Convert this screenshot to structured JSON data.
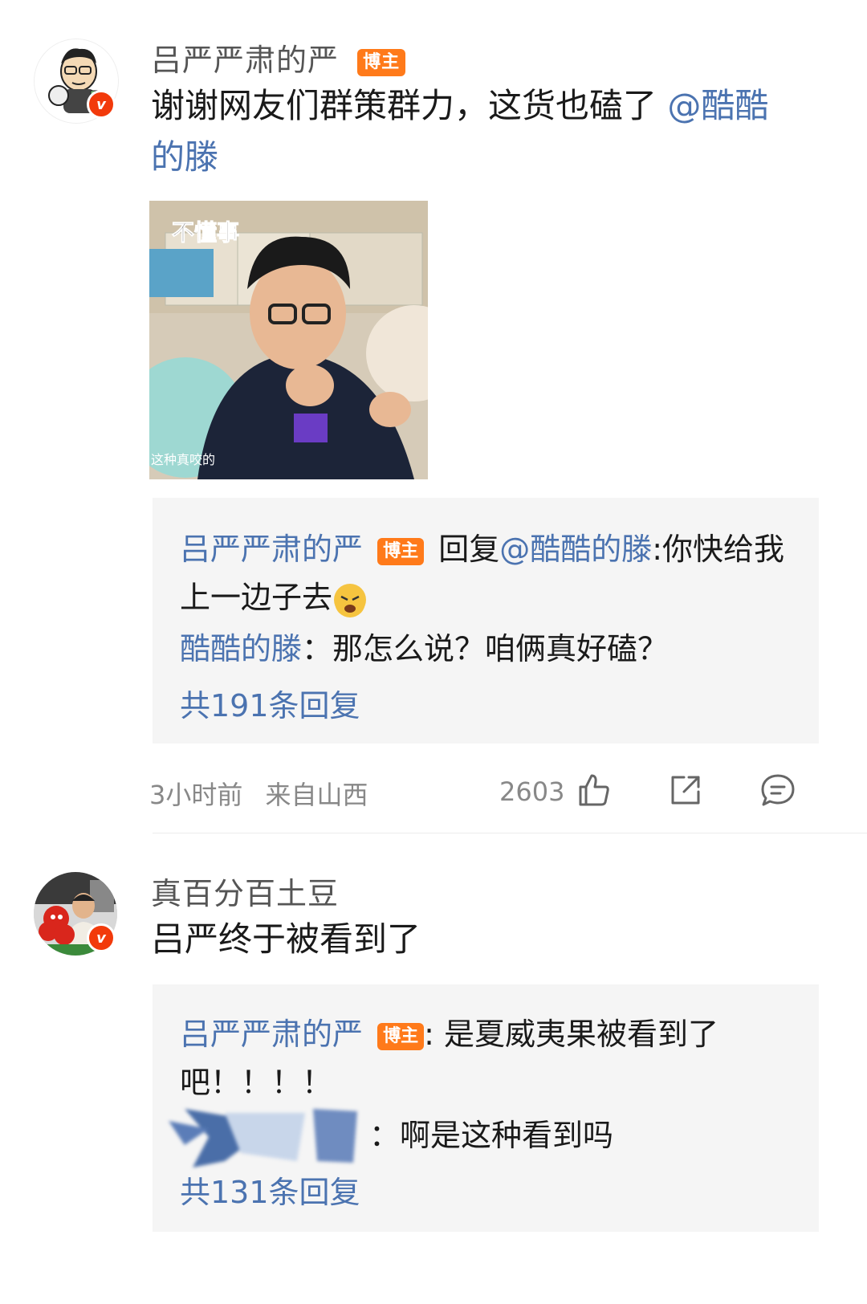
{
  "post1": {
    "username": "吕严严肃的严",
    "tag": "博主",
    "text": "谢谢网友们群策群力，这货也磕了 ",
    "mention": "@酷酷的滕",
    "image_caption_top": "不懂事",
    "image_caption_bottom": "这种真咬的",
    "replies": {
      "line1_user": "吕严严肃的严",
      "line1_tag": "博主",
      "line1_prefix": " 回复",
      "line1_mention": "@酷酷的滕",
      "line1_text": ":你快给我上一边子去",
      "line2_user": "酷酷的滕",
      "line2_text": "：那怎么说？咱俩真好磕？",
      "more": "共191条回复"
    },
    "time": "3小时前",
    "location": "来自山西",
    "likes": "2603"
  },
  "post2": {
    "username": "真百分百土豆",
    "text": "吕严终于被看到了",
    "replies": {
      "line1_user": "吕严严肃的严",
      "line1_tag": "博主",
      "line1_text": ": 是夏威夷果被看到了吧！！！！",
      "line2_text": "：啊是这种看到吗",
      "more": "共131条回复"
    }
  },
  "icons": {
    "like": "thumbs-up-icon",
    "share": "share-icon",
    "comment": "comment-icon",
    "verified": "verified-badge-icon"
  },
  "colors": {
    "link": "#4b73b0",
    "tag": "#ff7a1a",
    "verified": "#f23a0b"
  }
}
